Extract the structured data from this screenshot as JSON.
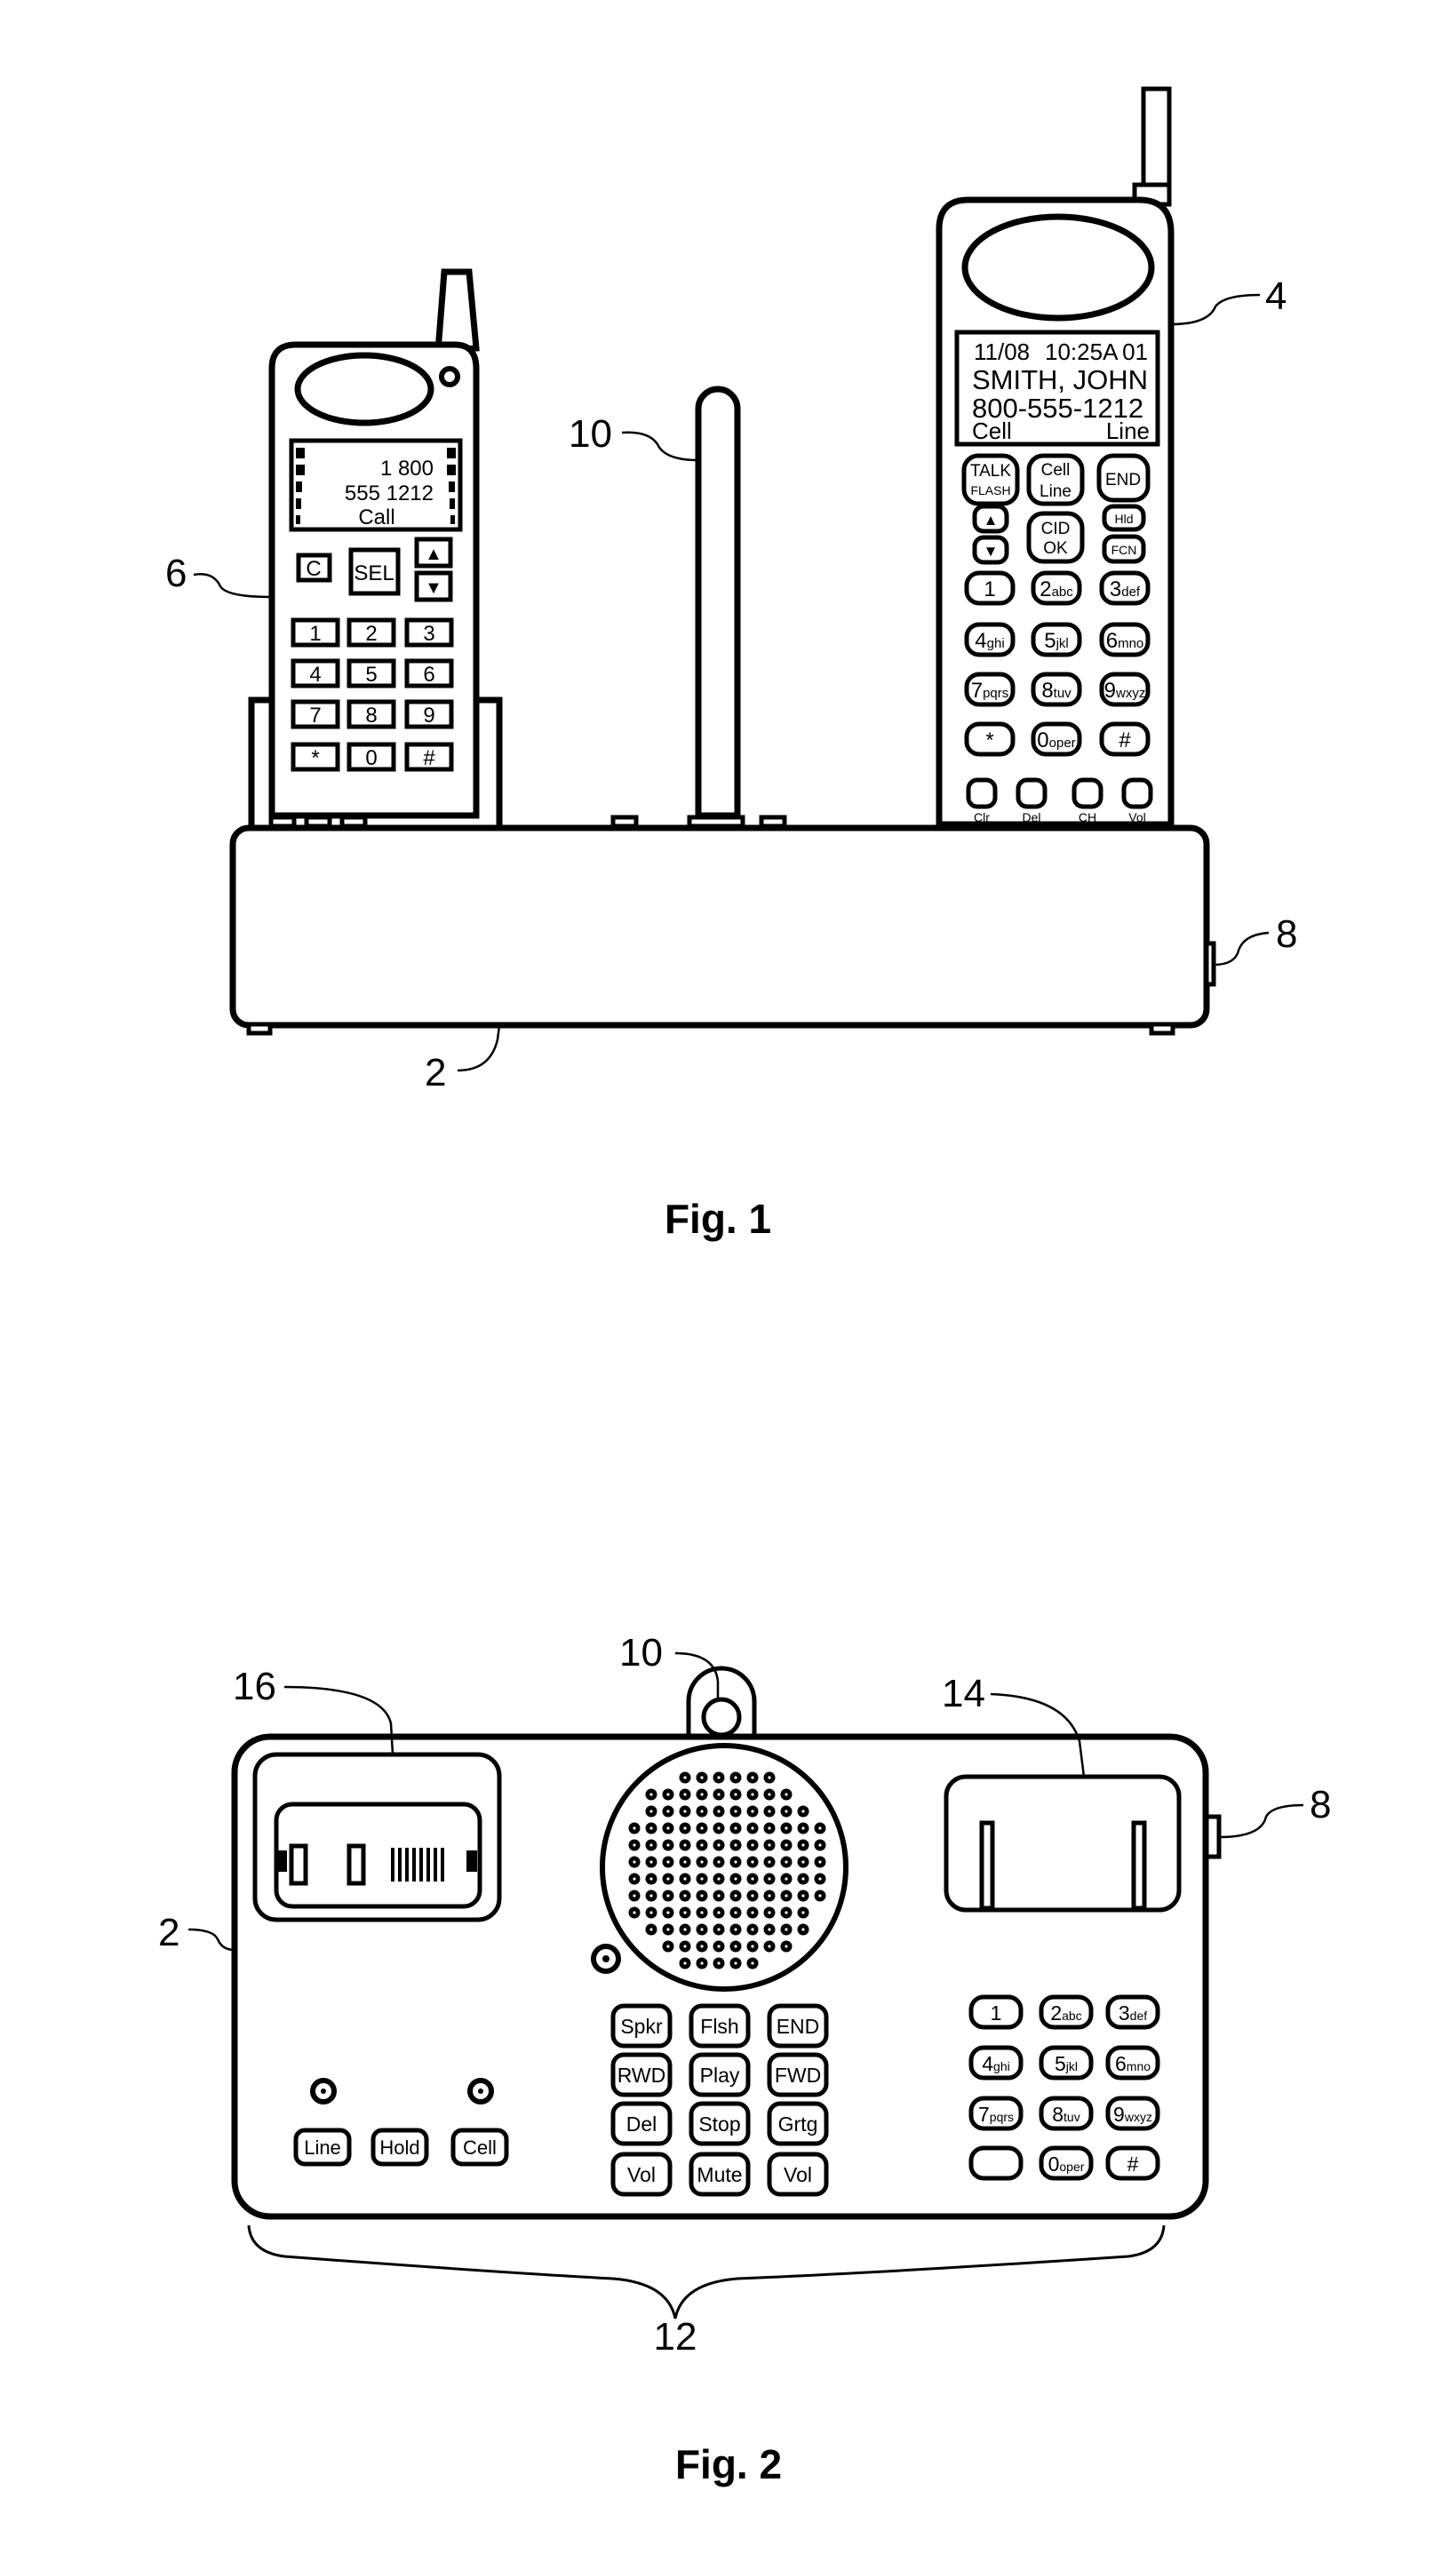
{
  "figures": [
    {
      "caption": "Fig. 1",
      "reference_numerals": {
        "base": "2",
        "handset_cellular": "4",
        "handset_cordless": "6",
        "connector": "8",
        "antenna": "10"
      },
      "small_handset": {
        "display_lines": [
          "1 800",
          "555 1212",
          "Call"
        ],
        "control_keys": [
          "C",
          "SEL",
          "▲",
          "▼"
        ],
        "keypad": [
          "1",
          "2",
          "3",
          "4",
          "5",
          "6",
          "7",
          "8",
          "9",
          "*",
          "0",
          "#"
        ]
      },
      "large_handset": {
        "display": {
          "date": "11/08",
          "time": "10:25A",
          "count": "01",
          "name": "SMITH, JOHN",
          "number": "800-555-1212",
          "softkey_left": "Cell",
          "softkey_right": "Line"
        },
        "function_keys": [
          {
            "main": "TALK",
            "sub": "FLASH"
          },
          {
            "main": "Cell",
            "sub": "Line"
          },
          {
            "main": "END",
            "sub": ""
          }
        ],
        "nav_keys": [
          "▲",
          "▼"
        ],
        "center_key": {
          "main": "CID",
          "sub": "OK"
        },
        "side_keys": [
          "Hld",
          "FCN"
        ],
        "keypad": [
          {
            "digit": "1",
            "letters": ""
          },
          {
            "digit": "2",
            "letters": "abc"
          },
          {
            "digit": "3",
            "letters": "def"
          },
          {
            "digit": "4",
            "letters": "ghi"
          },
          {
            "digit": "5",
            "letters": "jkl"
          },
          {
            "digit": "6",
            "letters": "mno"
          },
          {
            "digit": "7",
            "letters": "pqrs"
          },
          {
            "digit": "8",
            "letters": "tuv"
          },
          {
            "digit": "9",
            "letters": "wxyz"
          },
          {
            "digit": "*",
            "letters": ""
          },
          {
            "digit": "0",
            "letters": "oper"
          },
          {
            "digit": "#",
            "letters": ""
          }
        ],
        "bottom_keys": [
          "Clr",
          "Del",
          "CH",
          "Vol"
        ]
      }
    },
    {
      "caption": "Fig. 2",
      "reference_numerals": {
        "base": "2",
        "antenna": "10",
        "keys": "12",
        "cradle_cellular": "14",
        "cradle_cordless": "16",
        "connector": "8"
      },
      "line_keys": [
        "Line",
        "Hold",
        "Cell"
      ],
      "function_keys": [
        "Spkr",
        "Flsh",
        "END",
        "RWD",
        "Play",
        "FWD",
        "Del",
        "Stop",
        "Grtg",
        "Vol",
        "Mute",
        "Vol"
      ],
      "keypad": [
        {
          "digit": "1",
          "letters": ""
        },
        {
          "digit": "2",
          "letters": "abc"
        },
        {
          "digit": "3",
          "letters": "def"
        },
        {
          "digit": "4",
          "letters": "ghi"
        },
        {
          "digit": "5",
          "letters": "jkl"
        },
        {
          "digit": "6",
          "letters": "mno"
        },
        {
          "digit": "7",
          "letters": "pqrs"
        },
        {
          "digit": "8",
          "letters": "tuv"
        },
        {
          "digit": "9",
          "letters": "wxyz"
        },
        {
          "digit": "",
          "letters": ""
        },
        {
          "digit": "0",
          "letters": "oper"
        },
        {
          "digit": "#",
          "letters": ""
        }
      ]
    }
  ]
}
